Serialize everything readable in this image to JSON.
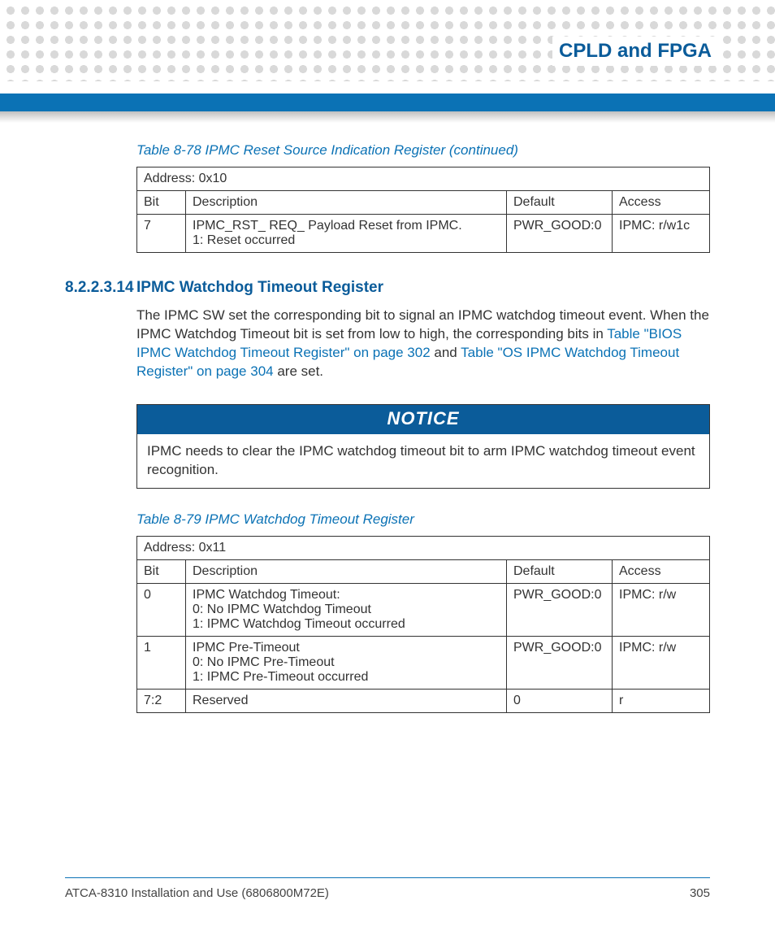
{
  "header": {
    "title": "CPLD and FPGA"
  },
  "table78": {
    "caption": "Table 8-78 IPMC Reset Source Indication Register (continued)",
    "address": "Address: 0x10",
    "cols": [
      "Bit",
      "Description",
      "Default",
      "Access"
    ],
    "rows": [
      {
        "bit": "7",
        "desc": "IPMC_RST_ REQ_ Payload Reset from IPMC.\n1: Reset occurred",
        "def": "PWR_GOOD:0",
        "acc": "IPMC: r/w1c"
      }
    ]
  },
  "section": {
    "number": "8.2.2.3.14",
    "title": "IPMC Watchdog Timeout Register",
    "para_pre": "The IPMC SW set the corresponding bit to signal an IPMC watchdog timeout event. When the IPMC Watchdog Timeout bit is set from low to high, the corresponding bits in ",
    "xref1": "Table \"BIOS IPMC Watchdog Timeout Register\" on page 302",
    "mid": " and ",
    "xref2": "Table \"OS IPMC Watchdog Timeout Register\" on page 304",
    "post": " are set."
  },
  "notice": {
    "label": "NOTICE",
    "text": "IPMC needs to clear the IPMC watchdog timeout bit to arm IPMC watchdog timeout event recognition."
  },
  "table79": {
    "caption": "Table 8-79 IPMC Watchdog Timeout Register",
    "address": "Address: 0x11",
    "cols": [
      "Bit",
      "Description",
      "Default",
      "Access"
    ],
    "rows": [
      {
        "bit": "0",
        "desc": "IPMC Watchdog Timeout:\n0: No IPMC Watchdog Timeout\n1: IPMC Watchdog Timeout occurred",
        "def": "PWR_GOOD:0",
        "acc": "IPMC: r/w"
      },
      {
        "bit": "1",
        "desc": "IPMC Pre-Timeout\n0: No IPMC Pre-Timeout\n1: IPMC Pre-Timeout occurred",
        "def": "PWR_GOOD:0",
        "acc": "IPMC: r/w"
      },
      {
        "bit": "7:2",
        "desc": "Reserved",
        "def": "0",
        "acc": "r"
      }
    ]
  },
  "footer": {
    "doc": "ATCA-8310 Installation and Use (6806800M72E)",
    "page": "305"
  }
}
